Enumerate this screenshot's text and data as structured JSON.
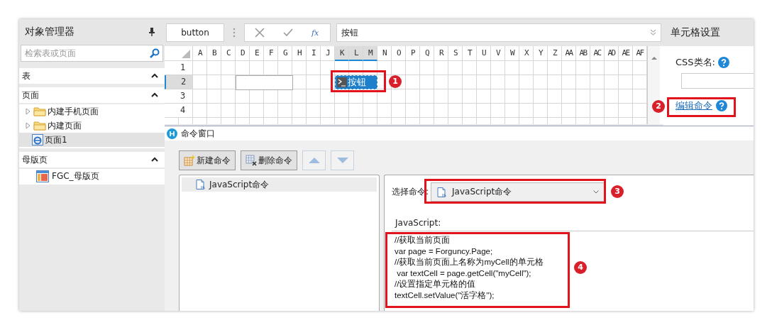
{
  "object_manager": {
    "title": "对象管理器",
    "search": {
      "placeholder": "检索表或页面"
    },
    "sections": [
      {
        "label": "表",
        "expanded": true
      },
      {
        "label": "页面",
        "expanded": true,
        "items": [
          {
            "label": "内建手机页面",
            "kind": "folder",
            "expanded": false,
            "selected": false
          },
          {
            "label": "内建页面",
            "kind": "folder",
            "expanded": false,
            "selected": false
          },
          {
            "label": "页面1",
            "kind": "page",
            "selected": true
          }
        ]
      },
      {
        "label": "母版页",
        "expanded": true,
        "items": [
          {
            "label": "FGC_母版页",
            "kind": "master",
            "selected": false
          }
        ]
      }
    ]
  },
  "formula_bar": {
    "name_box": "button",
    "function_label": "fx",
    "formula": "按钮"
  },
  "grid": {
    "columns": [
      {
        "label": "A",
        "selected": false
      },
      {
        "label": "B",
        "selected": false
      },
      {
        "label": "C",
        "selected": false
      },
      {
        "label": "D",
        "selected": false
      },
      {
        "label": "E",
        "selected": false
      },
      {
        "label": "F",
        "selected": false
      },
      {
        "label": "G",
        "selected": false
      },
      {
        "label": "H",
        "selected": false
      },
      {
        "label": "I",
        "selected": false
      },
      {
        "label": "J",
        "selected": false
      },
      {
        "label": "K",
        "selected": true
      },
      {
        "label": "L",
        "selected": true
      },
      {
        "label": "M",
        "selected": true
      },
      {
        "label": "N",
        "selected": false
      },
      {
        "label": "O",
        "selected": false
      },
      {
        "label": "P",
        "selected": false
      },
      {
        "label": "Q",
        "selected": false
      },
      {
        "label": "R",
        "selected": false
      },
      {
        "label": "S",
        "selected": false
      },
      {
        "label": "T",
        "selected": false
      },
      {
        "label": "U",
        "selected": false
      },
      {
        "label": "V",
        "selected": false
      },
      {
        "label": "W",
        "selected": false
      },
      {
        "label": "X",
        "selected": false
      },
      {
        "label": "Y",
        "selected": false
      },
      {
        "label": "Z",
        "selected": false
      },
      {
        "label": "AA",
        "selected": false
      },
      {
        "label": "AB",
        "selected": false
      },
      {
        "label": "AC",
        "selected": false
      },
      {
        "label": "AD",
        "selected": false
      },
      {
        "label": "AE",
        "selected": false
      },
      {
        "label": "AF",
        "selected": false
      }
    ],
    "rows": [
      {
        "label": "1",
        "selected": false
      },
      {
        "label": "2",
        "selected": true
      },
      {
        "label": "3",
        "selected": false
      },
      {
        "label": "4",
        "selected": false
      }
    ],
    "button_cell": {
      "text": "按钮"
    }
  },
  "cell_settings": {
    "title": "单元格设置",
    "css_label": "CSS类名:",
    "edit_command_link": "编辑命令"
  },
  "command_window": {
    "title": "命令窗口",
    "toolbar": [
      {
        "kind": "new",
        "label": "新建命令",
        "disabled": false
      },
      {
        "kind": "delete",
        "label": "删除命令",
        "disabled": false
      },
      {
        "kind": "up",
        "disabled": true
      },
      {
        "kind": "down",
        "disabled": true
      }
    ],
    "commands": [
      {
        "label": "JavaScript命令",
        "selected": true
      }
    ],
    "select_label": "选择命令:",
    "selected_command": "JavaScript命令",
    "code_label": "JavaScript:",
    "code_lines": [
      "//获取当前页面",
      "var page = Forguncy.Page;",
      "//获取当前页面上名称为myCell的单元格",
      " var textCell = page.getCell(\"myCell\");",
      "//设置指定单元格的值",
      "textCell.setValue(\"活字格\");"
    ]
  },
  "annotations": [
    {
      "number": "1"
    },
    {
      "number": "2"
    },
    {
      "number": "3"
    },
    {
      "number": "4"
    }
  ]
}
